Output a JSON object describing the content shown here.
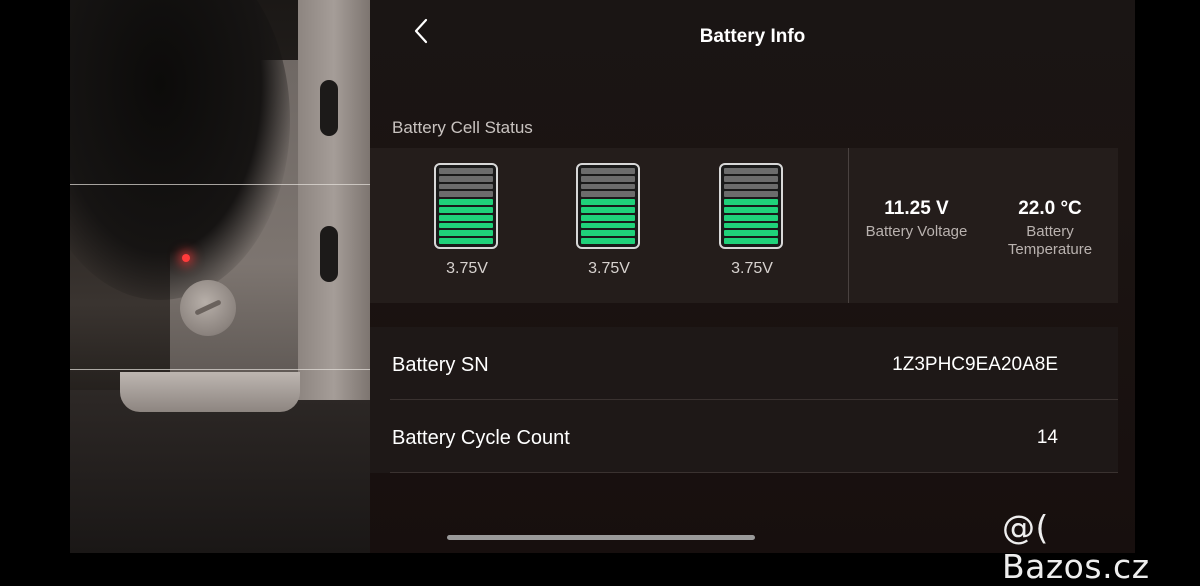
{
  "header": {
    "title": "Battery Info",
    "back_icon": "chevron-left-icon"
  },
  "cell_status": {
    "label": "Battery Cell Status",
    "cells": [
      {
        "voltage": "3.75V",
        "fill_level": 0.6
      },
      {
        "voltage": "3.75V",
        "fill_level": 0.6
      },
      {
        "voltage": "3.75V",
        "fill_level": 0.6
      }
    ],
    "voltage": {
      "value": "11.25 V",
      "label": "Battery Voltage"
    },
    "temperature": {
      "value": "22.0 °C",
      "label_line1": "Battery",
      "label_line2": "Temperature"
    }
  },
  "info": {
    "serial": {
      "label": "Battery SN",
      "value": "1Z3PHC9EA20A8E"
    },
    "cycle_count": {
      "label": "Battery Cycle Count",
      "value": "14"
    }
  },
  "watermark": "@( Bazos.cz",
  "colors": {
    "cell_full": "#1fd27a",
    "cell_empty": "#6c6c6c",
    "background": "#1a1514"
  }
}
